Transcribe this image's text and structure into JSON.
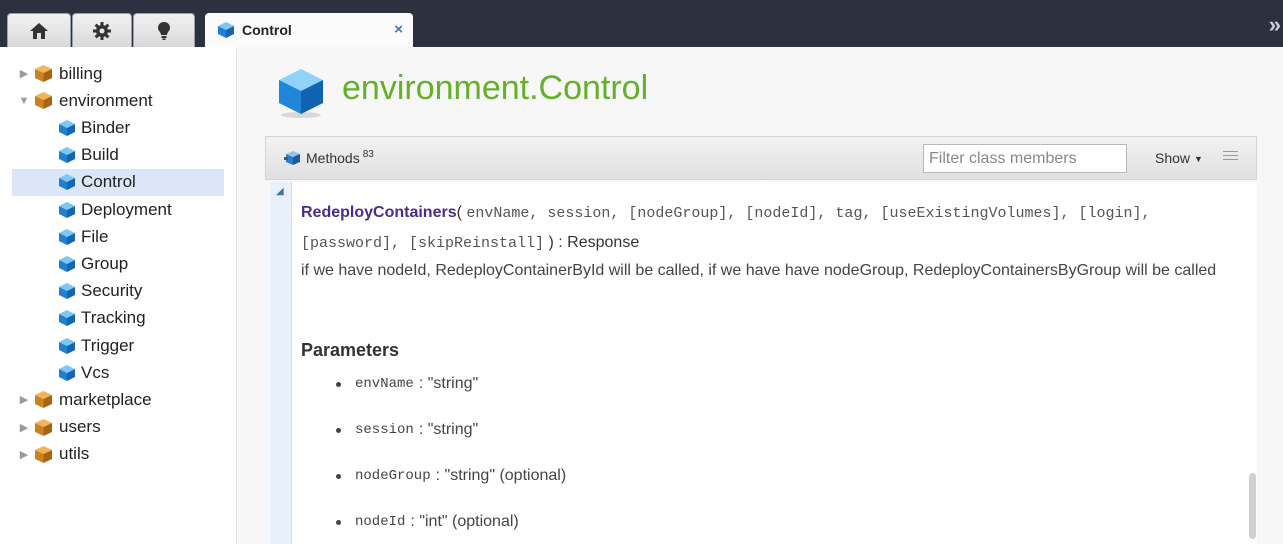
{
  "tabs": {
    "active_label": "Control",
    "close_glyph": "×",
    "expand_glyph": "»"
  },
  "tree": [
    {
      "label": "billing",
      "kind": "package",
      "expanded": false
    },
    {
      "label": "environment",
      "kind": "package",
      "expanded": true
    },
    {
      "label": "Binder",
      "kind": "class"
    },
    {
      "label": "Build",
      "kind": "class"
    },
    {
      "label": "Control",
      "kind": "class",
      "selected": true
    },
    {
      "label": "Deployment",
      "kind": "class"
    },
    {
      "label": "File",
      "kind": "class"
    },
    {
      "label": "Group",
      "kind": "class"
    },
    {
      "label": "Security",
      "kind": "class"
    },
    {
      "label": "Tracking",
      "kind": "class"
    },
    {
      "label": "Trigger",
      "kind": "class"
    },
    {
      "label": "Vcs",
      "kind": "class"
    },
    {
      "label": "marketplace",
      "kind": "package",
      "expanded": false
    },
    {
      "label": "users",
      "kind": "package",
      "expanded": false
    },
    {
      "label": "utils",
      "kind": "package",
      "expanded": false
    }
  ],
  "main": {
    "title": "environment.Control",
    "toolbar": {
      "methods_label": "Methods",
      "methods_count": "83",
      "filter_placeholder": "Filter class members",
      "show_label": "Show"
    },
    "method": {
      "name": "RedeployContainers",
      "open_paren": "(",
      "params_signature": "envName, session, [nodeGroup], [nodeId], tag, [useExistingVolumes], [login], [password], [skipReinstall]",
      "close": ") : Response",
      "description": "if we have nodeId, RedeployContainerById will be called, if we have have nodeGroup, RedeployContainersByGroup will be called"
    },
    "parameters_heading": "Parameters",
    "parameters": [
      {
        "name": "envName",
        "type": ": \"string\""
      },
      {
        "name": "session",
        "type": ": \"string\""
      },
      {
        "name": "nodeGroup",
        "type": ": \"string\" (optional)"
      },
      {
        "name": "nodeId",
        "type": ": \"int\" (optional)"
      }
    ]
  },
  "colors": {
    "topbar": "#2c3140",
    "title_green": "#64b02a",
    "method_name": "#4b2b91",
    "selected_row": "#dbe7f8"
  },
  "icons": [
    "home-icon",
    "gear-icon",
    "lightbulb-icon",
    "class-cube-icon",
    "package-box-icon"
  ]
}
